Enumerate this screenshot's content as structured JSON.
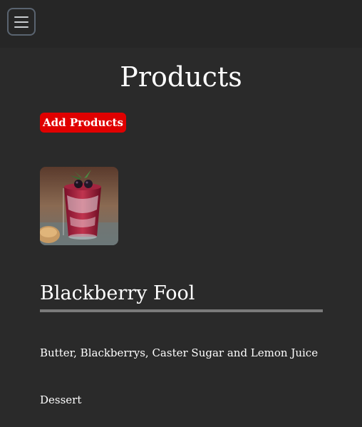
{
  "header": {
    "menu_icon": "hamburger-menu-icon"
  },
  "main": {
    "title": "Products",
    "add_button_label": "Add Products"
  },
  "product": {
    "name": "Blackberry Fool",
    "ingredients": "Butter, Blackberrys, Caster Sugar and Lemon Juice",
    "category": "Dessert",
    "image_alt_icon": "blackberry-dessert-photo"
  },
  "colors": {
    "background": "#2a2a2a",
    "topbar": "#262626",
    "accent_button": "#e00000",
    "divider": "#7a7a7a"
  }
}
